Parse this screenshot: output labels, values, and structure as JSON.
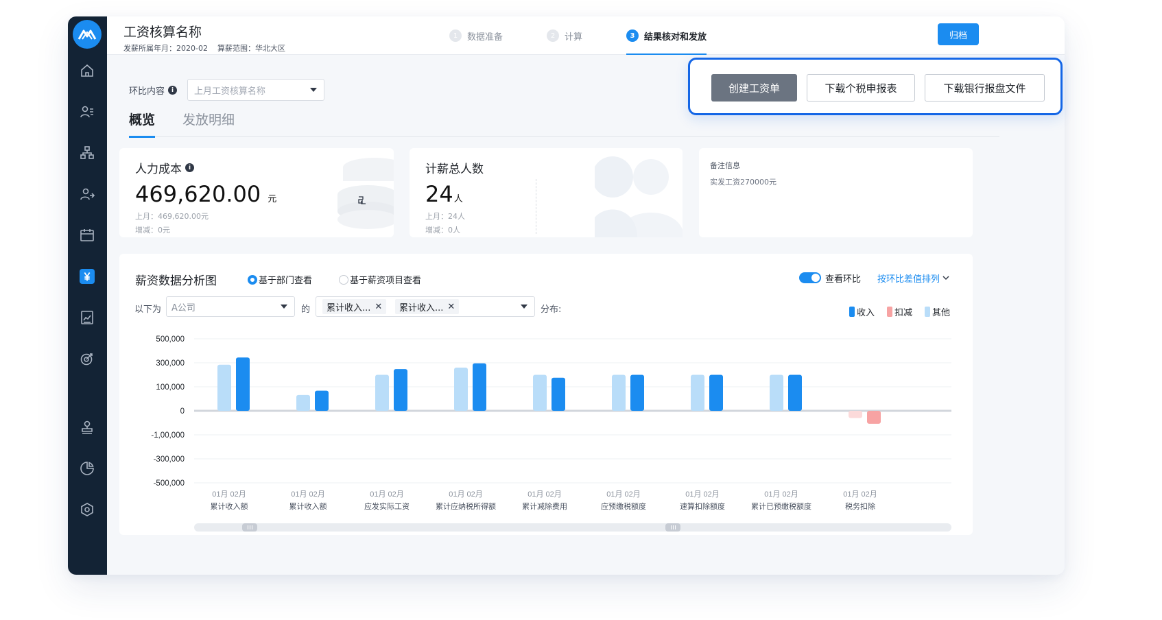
{
  "header": {
    "title": "工资核算名称",
    "period": "发薪所属年月：2020-02",
    "scope": "算薪范围：华北大区",
    "archive_label": "归档"
  },
  "steps": [
    {
      "num": "1",
      "label": "数据准备"
    },
    {
      "num": "2",
      "label": "计算"
    },
    {
      "num": "3",
      "label": "结果核对和发放"
    }
  ],
  "compare": {
    "label": "环比内容",
    "placeholder": "上月工资核算名称"
  },
  "tabs": [
    {
      "label": "概览"
    },
    {
      "label": "发放明细"
    }
  ],
  "actions": {
    "create": "创建工资单",
    "tax_report": "下载个税申报表",
    "bank_file": "下载银行报盘文件"
  },
  "cards": {
    "cost": {
      "title": "人力成本",
      "value": "469,620.00",
      "unit": "元",
      "last_month": "上月：469,620.00元",
      "change": "增减：0元"
    },
    "headcount": {
      "title": "计薪总人数",
      "value": "24",
      "unit": "人",
      "last_month": "上月：24人",
      "change": "增减：0人"
    },
    "note": {
      "title": "备注信息",
      "text": "实发工资270000元"
    }
  },
  "analysis": {
    "title": "薪资数据分析图",
    "radio_dept": "基于部门查看",
    "radio_item": "基于薪资项目查看",
    "toggle_label": "查看环比",
    "sort_label": "按环比差值排列",
    "filter_prefix": "以下为",
    "company": "A公司",
    "filter_of": "的",
    "chips": [
      "累计收入...",
      "累计收入..."
    ],
    "filter_suffix": "分布:",
    "legend": [
      {
        "label": "收入",
        "color": "#1b8cf0"
      },
      {
        "label": "扣减",
        "color": "#f7a3a3"
      },
      {
        "label": "其他",
        "color": "#b9ddf9"
      }
    ]
  },
  "chart_data": {
    "type": "bar",
    "y_ticks": [
      "500,000",
      "300,000",
      "100,000",
      "0",
      "-1,00,000",
      "-300,000",
      "-500,000"
    ],
    "categories": [
      "累计收入额",
      "累计收入额",
      "应发实际工资",
      "累计应纳税所得额",
      "累计减除费用",
      "应预缴税额度",
      "速算扣除额度",
      "累计已预缴税额度",
      "税务扣除"
    ],
    "period_labels": [
      "01月",
      "02月"
    ],
    "series": [
      {
        "name": "01月",
        "values": [
          320000,
          110000,
          250000,
          300000,
          250000,
          250000,
          250000,
          250000,
          -50000
        ]
      },
      {
        "name": "02月",
        "values": [
          370000,
          140000,
          290000,
          330000,
          230000,
          250000,
          250000,
          250000,
          -90000
        ]
      }
    ],
    "bar_types": [
      "收入",
      "收入",
      "收入",
      "收入",
      "收入",
      "收入",
      "收入",
      "收入",
      "扣减"
    ],
    "grid": true,
    "legend_position": "top-right"
  }
}
